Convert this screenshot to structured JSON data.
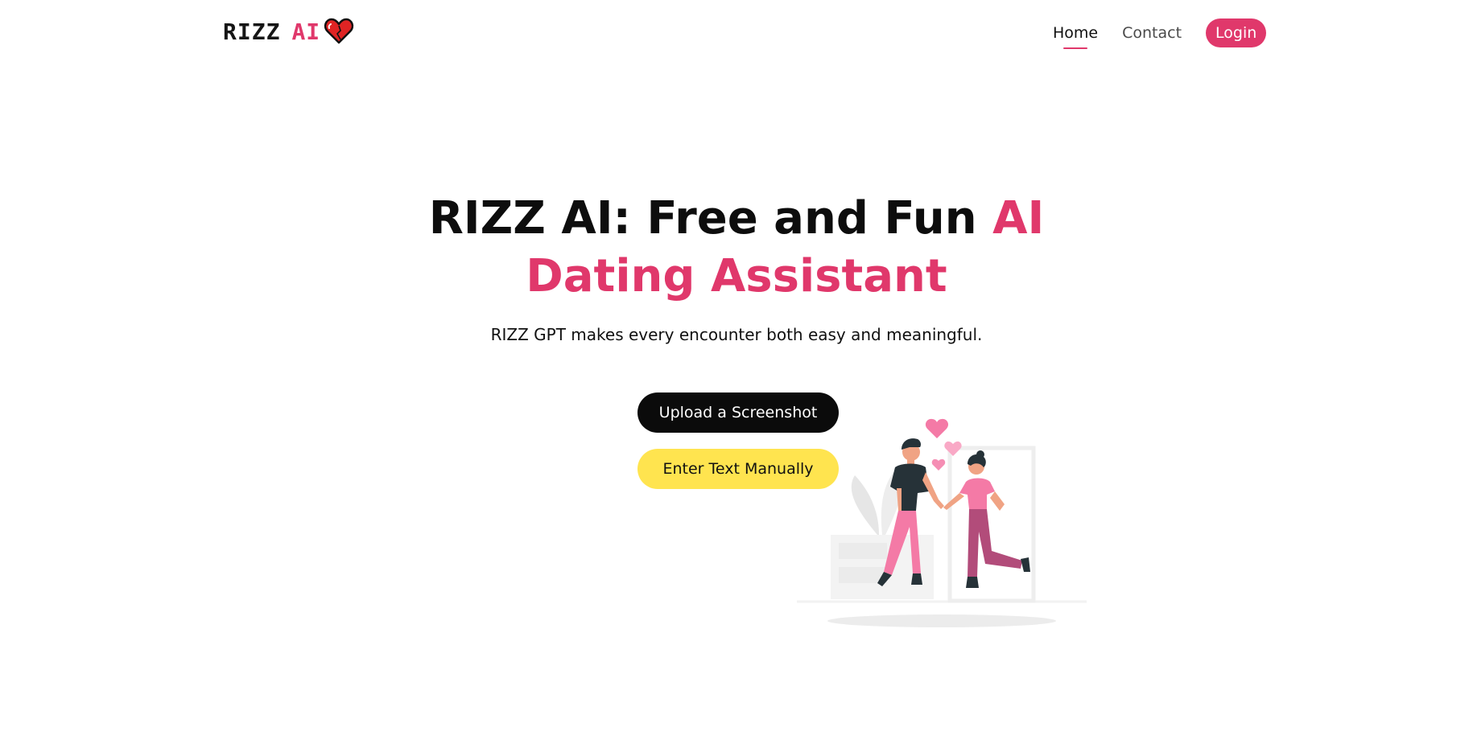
{
  "header": {
    "logo": {
      "text": "RIZZ",
      "accent": "AI",
      "icon": "heart-icon"
    },
    "nav": {
      "home_label": "Home",
      "contact_label": "Contact",
      "login_label": "Login"
    }
  },
  "hero": {
    "title_line1": "RIZZ AI: Free and Fun",
    "title_accent1": "AI",
    "title_line2": "Dating Assistant",
    "subtitle": "RIZZ GPT makes every encounter both easy and meaningful.",
    "upload_button_label": "Upload a Screenshot",
    "manual_button_label": "Enter Text Manually",
    "illustration": "couple-holding-hands-illustration"
  },
  "colors": {
    "accent": "#e0386b",
    "primary_button": "#0b0b0b",
    "secondary_button": "#ffe44f"
  }
}
